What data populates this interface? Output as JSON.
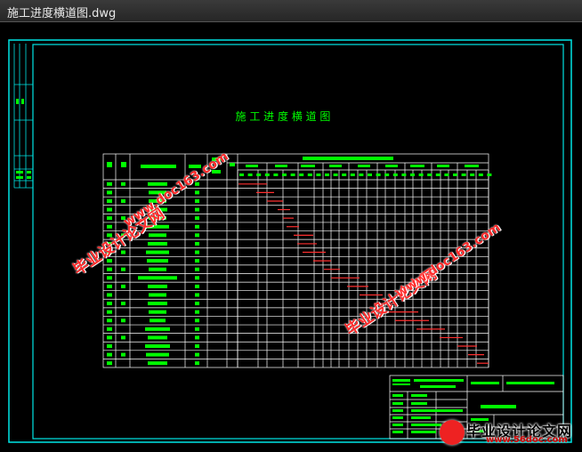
{
  "window": {
    "title": "施工进度横道图.dwg"
  },
  "drawing": {
    "chart_title": "施 工 进 度 横 道 图",
    "colors": {
      "frame": "#00e5e5",
      "table": "#ffffff",
      "label": "#00ff00",
      "bar": "#ff3030",
      "title": "#00ff00"
    }
  },
  "watermarks": {
    "cn": "毕业设计论文网",
    "url": "www.doc163.com",
    "footer_cn": "毕业设计论文网",
    "footer_url": "www.56doc.com"
  }
}
